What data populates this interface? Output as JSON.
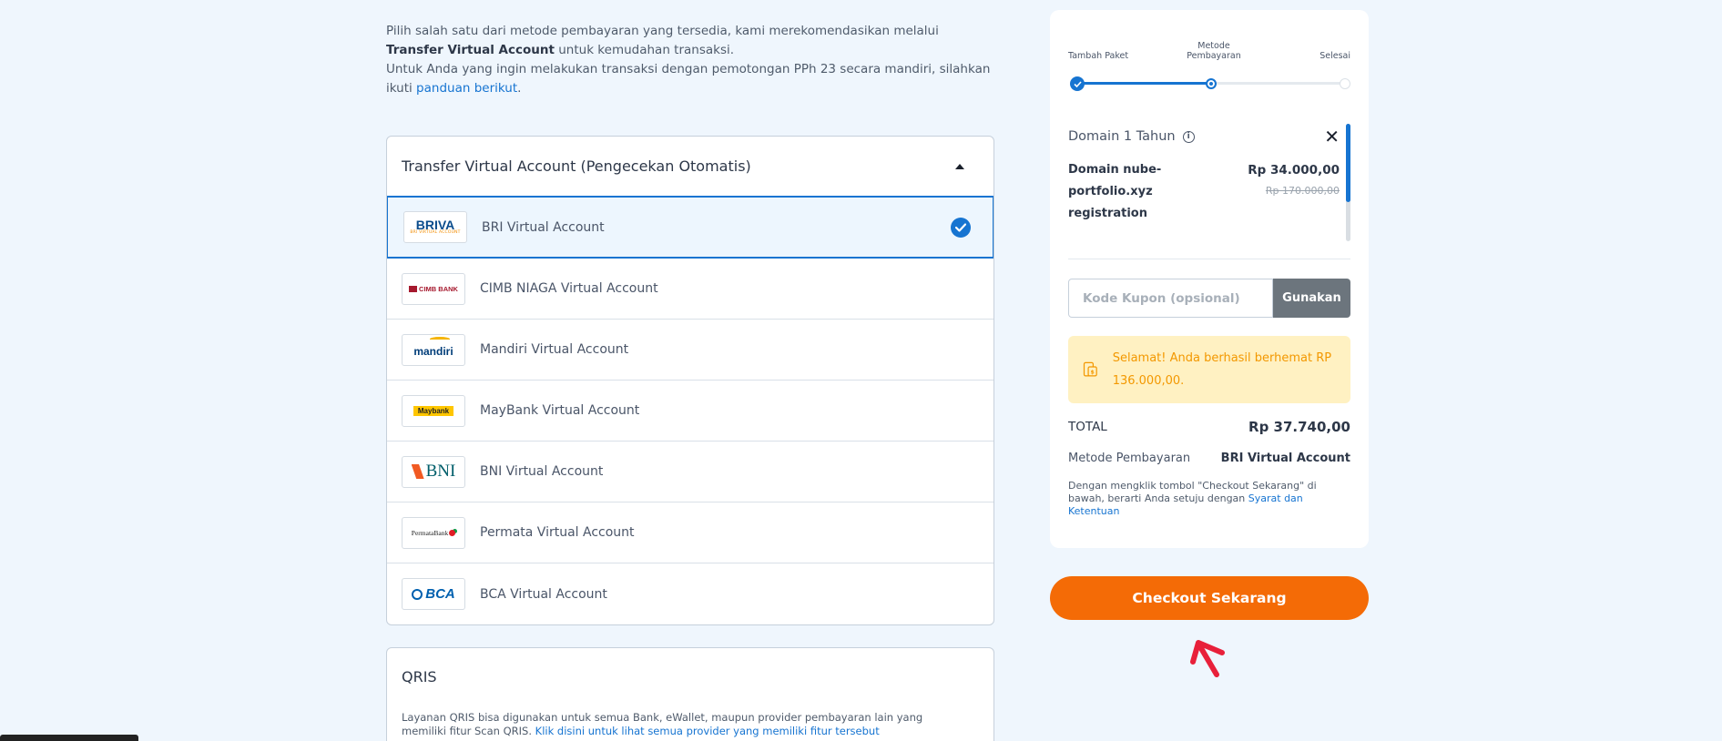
{
  "intro": {
    "line1_pre": "Pilih salah satu dari metode pembayaran yang tersedia, kami merekomendasikan melalui ",
    "line1_bold": "Transfer Virtual Account",
    "line1_post": " untuk kemudahan transaksi.",
    "line2_pre": "Untuk Anda yang ingin melakukan transaksi dengan pemotongan PPh 23 secara mandiri, silahkan ikuti ",
    "line2_link": "panduan berikut",
    "line2_post": "."
  },
  "va_section": {
    "title": "Transfer Virtual Account (Pengecekan Otomatis)",
    "items": [
      {
        "label": "BRI Virtual Account",
        "logo": "BRIVA",
        "selected": true
      },
      {
        "label": "CIMB NIAGA Virtual Account",
        "logo": "CIMB BANK"
      },
      {
        "label": "Mandiri Virtual Account",
        "logo": "mandiri"
      },
      {
        "label": "MayBank Virtual Account",
        "logo": "Maybank"
      },
      {
        "label": "BNI Virtual Account",
        "logo": "BNI"
      },
      {
        "label": "Permata Virtual Account",
        "logo": "PermataBank"
      },
      {
        "label": "BCA Virtual Account",
        "logo": "BCA"
      }
    ],
    "briva_sub": "BRI VIRTUAL ACCOUNT"
  },
  "qris": {
    "title": "QRIS",
    "desc": "Layanan QRIS bisa digunakan untuk semua Bank, eWallet, maupun provider pembayaran lain yang memiliki fitur Scan QRIS. ",
    "link": "Klik disini untuk lihat semua provider yang memiliki fitur tersebut"
  },
  "summary": {
    "steps": [
      "Tambah Paket",
      "Metode Pembayaran",
      "Selesai"
    ],
    "item_title": "Domain 1 Tahun",
    "item_name": "Domain nube-portfolio.xyz registration",
    "price": "Rp 34.000,00",
    "old_price": "Rp 170.000,00",
    "coupon_placeholder": "Kode Kupon (opsional)",
    "coupon_button": "Gunakan",
    "promo": "Selamat! Anda berhasil berhemat RP 136.000,00.",
    "total_label": "TOTAL",
    "total_value": "Rp 37.740,00",
    "method_label": "Metode Pembayaran",
    "method_value": "BRI Virtual Account",
    "agree_text": "Dengan mengklik tombol \"Checkout Sekarang\" di bawah, berarti Anda setuju dengan ",
    "agree_link": "Syarat dan Ketentuan"
  },
  "checkout_label": "Checkout Sekarang",
  "colors": {
    "accent": "#1674d1",
    "checkout": "#f46b06",
    "promo_bg": "#fff1c2",
    "promo_text": "#f39800",
    "arrow": "#e8203a"
  }
}
